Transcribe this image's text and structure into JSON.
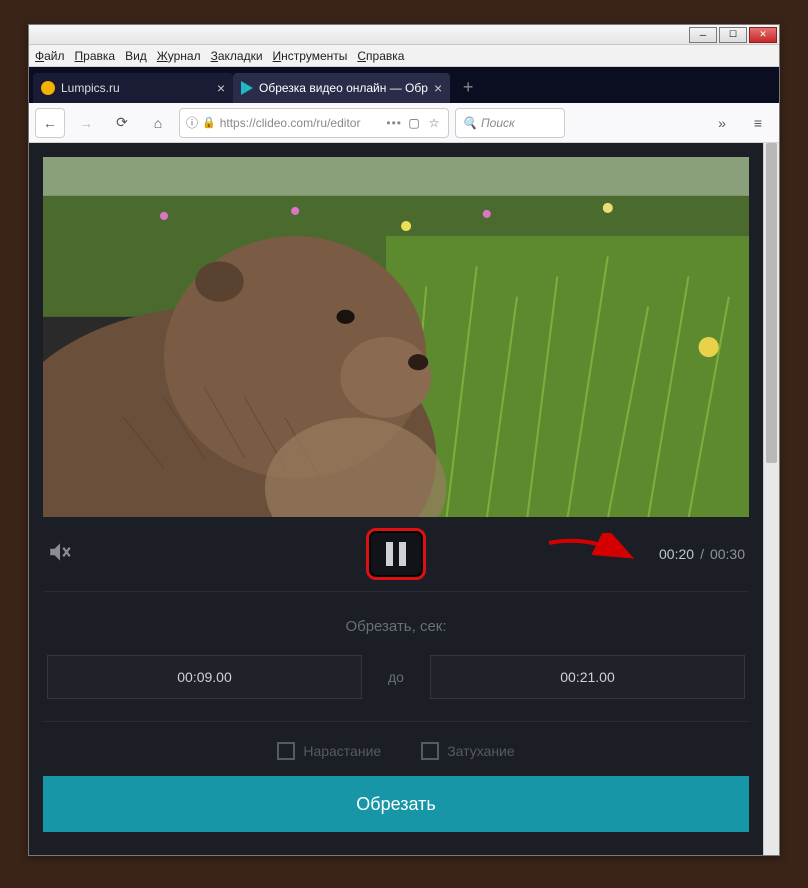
{
  "menu": {
    "file": "Файл",
    "edit": "Правка",
    "view": "Вид",
    "history": "Журнал",
    "bookmarks": "Закладки",
    "tools": "Инструменты",
    "help": "Справка"
  },
  "tabs": [
    {
      "label": "Lumpics.ru"
    },
    {
      "label": "Обрезка видео онлайн — Обр"
    }
  ],
  "url": {
    "display": "https://clideo.com/ru/editor",
    "scheme_shown": "https://"
  },
  "search": {
    "placeholder": "Поиск"
  },
  "player": {
    "current_time": "00:20",
    "total_time": "00:30"
  },
  "trim": {
    "section_label": "Обрезать, сек:",
    "from_value": "00:09.00",
    "to_label": "до",
    "to_value": "00:21.00"
  },
  "fade": {
    "rise": "Нарастание",
    "fall": "Затухание"
  },
  "cut_button": "Обрезать"
}
